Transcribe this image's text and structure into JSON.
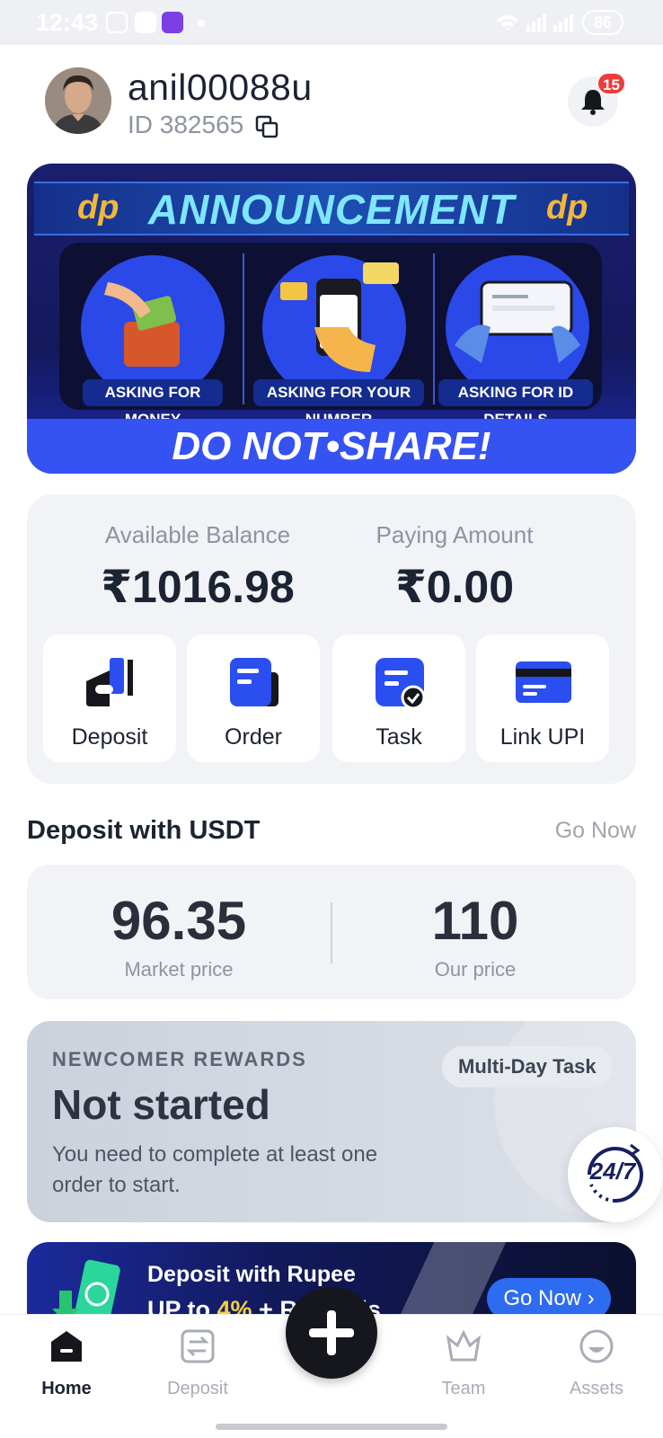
{
  "status_bar": {
    "time": "12:43",
    "battery": "86"
  },
  "header": {
    "username": "anil00088u",
    "id_label": "ID 382565",
    "notification_count": "15"
  },
  "banner": {
    "title": "ANNOUNCEMENT",
    "logo_text": "dp",
    "items": [
      {
        "caption": "ASKING FOR MONEY"
      },
      {
        "caption": "ASKING FOR YOUR NUMBER"
      },
      {
        "caption": "ASKING FOR ID DETAILS"
      }
    ],
    "footer": "DO NOT•SHARE!"
  },
  "balance": {
    "available_label": "Available Balance",
    "available_value": "₹1016.98",
    "paying_label": "Paying Amount",
    "paying_value": "₹0.00"
  },
  "actions": [
    {
      "label": "Deposit",
      "icon": "wallet-icon"
    },
    {
      "label": "Order",
      "icon": "order-icon"
    },
    {
      "label": "Task",
      "icon": "task-icon"
    },
    {
      "label": "Link UPI",
      "icon": "card-icon"
    }
  ],
  "usdt": {
    "title": "Deposit with USDT",
    "go_now": "Go Now",
    "market_price": "96.35",
    "market_label": "Market price",
    "our_price": "110",
    "our_label": "Our price"
  },
  "newcomer": {
    "kicker": "NEWCOMER REWARDS",
    "status": "Not started",
    "description": "You need to complete at least one order to start.",
    "pill": "Multi-Day Task"
  },
  "support": {
    "label": "24/7"
  },
  "promo": {
    "line1": "Deposit with Rupee",
    "line2_prefix": "UP to ",
    "line2_highlight": "4%",
    "line2_suffix": " + ",
    "line2_end": "Rewards",
    "button": "Go Now"
  },
  "bottom_nav": [
    {
      "label": "Home",
      "active": true
    },
    {
      "label": "Deposit",
      "active": false
    },
    {
      "label": "Team",
      "active": false
    },
    {
      "label": "Assets",
      "active": false
    }
  ],
  "colors": {
    "accent": "#2b4ef0",
    "badge": "#ef3b3b",
    "dark": "#1c2333"
  }
}
